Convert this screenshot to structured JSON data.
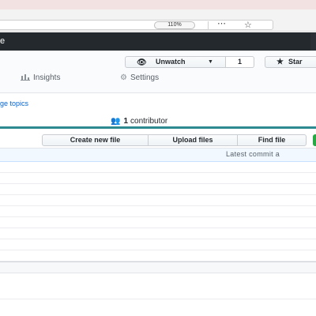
{
  "browser": {
    "zoom": "110%",
    "more_icon": "⋯",
    "bookmark_icon": "☆"
  },
  "header": {
    "fragment": "e"
  },
  "repo": {
    "watch_label": "Unwatch",
    "watch_count": "1",
    "star_label": "Star",
    "tabs": [
      {
        "label": "Insights",
        "icon": "bar-chart-icon"
      },
      {
        "label": "Settings",
        "icon": "gear-icon"
      }
    ],
    "topics_link": "ge topics",
    "contributors_count": "1",
    "contributors_label": "contributor"
  },
  "files": {
    "buttons": {
      "create": "Create new file",
      "upload": "Upload files",
      "find": "Find file"
    },
    "latest_commit_label": "Latest commit a"
  },
  "colors": {
    "header_bg": "#24292e",
    "link": "#0366d6",
    "summary_border": "#2c8a90",
    "clone_button": "#28a745",
    "commit_tease_bg": "#f1f8ff"
  }
}
